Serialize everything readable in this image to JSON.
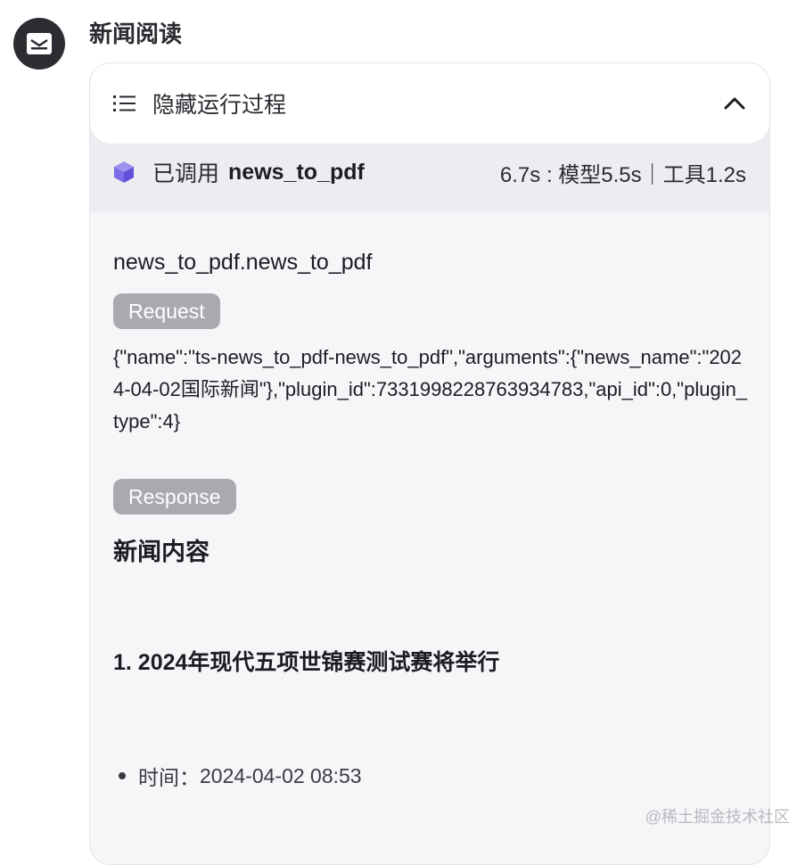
{
  "bot": {
    "name": "新闻阅读",
    "avatar_icon": "newspaper-icon"
  },
  "process": {
    "toggle_label": "隐藏运行过程",
    "list_icon": "list-icon",
    "collapse_icon": "chevron-up-icon"
  },
  "call": {
    "icon": "cube-icon",
    "called_label": "已调用",
    "tool_name": "news_to_pdf",
    "timing": "6.7s : 模型5.5s｜工具1.2s"
  },
  "detail": {
    "function_name": "news_to_pdf.news_to_pdf",
    "request_label": "Request",
    "request_body": "{\"name\":\"ts-news_to_pdf-news_to_pdf\",\"arguments\":{\"news_name\":\"2024-04-02国际新闻\"},\"plugin_id\":7331998228763934783,\"api_id\":0,\"plugin_type\":4}",
    "response_label": "Response",
    "response_title": "新闻内容",
    "news_item_heading": "1. 2024年现代五项世锦赛测试赛将举行",
    "time_label": "时间：",
    "time_value": "2024-04-02 08:53"
  },
  "watermark": "@稀土掘金技术社区",
  "colors": {
    "accent_cube": "#7b6ee8",
    "pill_bg": "#a9aab0",
    "card_bg": "#f6f6f8"
  }
}
